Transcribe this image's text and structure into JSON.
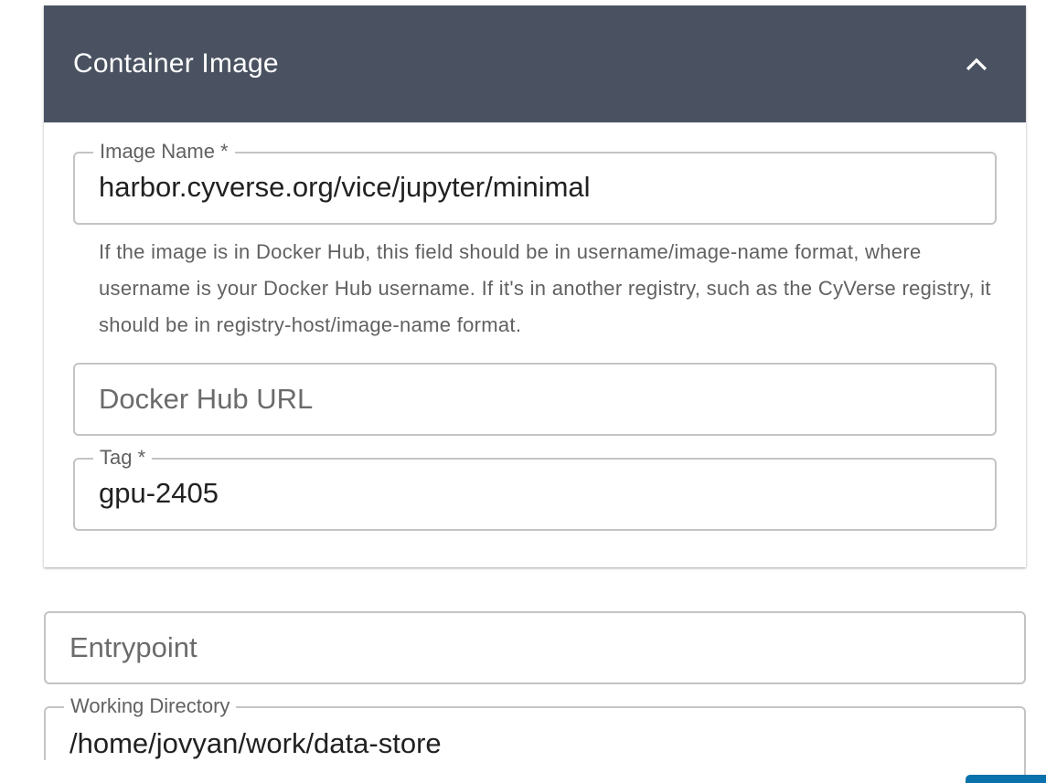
{
  "section": {
    "title": "Container Image",
    "collapse_icon": "chevron-up-icon"
  },
  "image_name": {
    "label": "Image Name *",
    "value": "harbor.cyverse.org/vice/jupyter/minimal",
    "helper": "If the image is in Docker Hub, this field should be in username/image-name format, where username is your Docker Hub username. If it's in another registry, such as the CyVerse registry, it should be in registry-host/image-name format."
  },
  "docker_hub_url": {
    "placeholder": "Docker Hub URL"
  },
  "tag": {
    "label": "Tag *",
    "value": "gpu-2405"
  },
  "entrypoint": {
    "placeholder": "Entrypoint"
  },
  "working_directory": {
    "label": "Working Directory",
    "value": "/home/jovyan/work/data-store"
  },
  "colors": {
    "header_background": "#4a5261",
    "field_border": "#c4c4c4",
    "accent_button": "#0971ab"
  }
}
